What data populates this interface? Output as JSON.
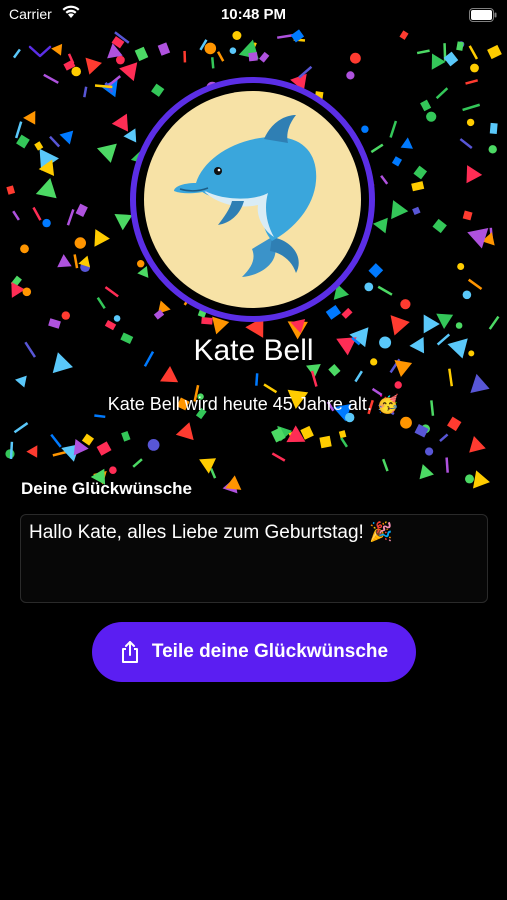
{
  "status_bar": {
    "carrier": "Carrier",
    "time": "10:48 PM",
    "icons": [
      "wifi-icon",
      "battery-icon"
    ]
  },
  "header": {
    "collapse_icon": "chevron-down-icon"
  },
  "profile": {
    "avatar_icon": "dolphin-emoji",
    "name": "Kate Bell",
    "age_text": "Kate Bell wird heute 45 Jahre alt. 🥳"
  },
  "wishes": {
    "heading": "Deine Glückwünsche",
    "message": "Hallo Kate, alles Liebe zum Geburtstag! 🎉"
  },
  "share": {
    "label": "Teile deine Glückwünsche",
    "icon": "share-icon"
  },
  "colors": {
    "accent": "#5b1ef2",
    "ring": "#5b2ee6",
    "avatar_bg": "#f7e2a6",
    "background": "#000000"
  }
}
